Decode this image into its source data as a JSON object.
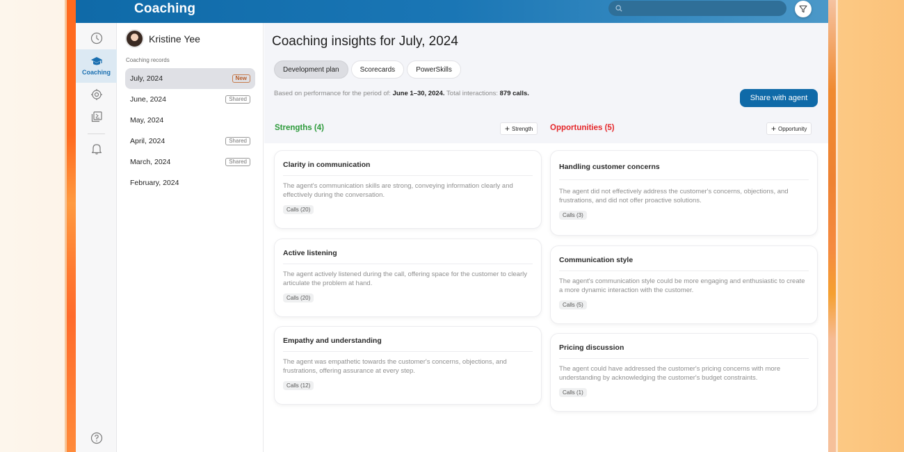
{
  "app": {
    "title": "Coaching",
    "search_placeholder": "",
    "icons": {
      "search": "search-icon",
      "filter": "filter-icon"
    }
  },
  "rail": {
    "items": [
      {
        "name": "history",
        "icon": "clock-icon",
        "label": ""
      },
      {
        "name": "coaching",
        "icon": "graduation-cap-icon",
        "label": "Coaching",
        "active": true
      },
      {
        "name": "targets",
        "icon": "target-icon",
        "label": ""
      },
      {
        "name": "library",
        "icon": "media-library-icon",
        "label": ""
      },
      {
        "name": "notifications",
        "icon": "bell-icon",
        "label": ""
      },
      {
        "name": "help",
        "icon": "help-icon",
        "label": ""
      }
    ]
  },
  "records": {
    "agent_name": "Kristine Yee",
    "section_label": "Coaching records",
    "items": [
      {
        "label": "July, 2024",
        "badge": "New",
        "active": true
      },
      {
        "label": "June, 2024",
        "badge": "Shared"
      },
      {
        "label": "May, 2024",
        "badge": ""
      },
      {
        "label": "April, 2024",
        "badge": "Shared"
      },
      {
        "label": "March, 2024",
        "badge": "Shared"
      },
      {
        "label": "February, 2024",
        "badge": ""
      }
    ]
  },
  "main": {
    "title": "Coaching insights for July, 2024",
    "tabs": [
      {
        "label": "Development plan",
        "active": true
      },
      {
        "label": "Scorecards"
      },
      {
        "label": "PowerSkills"
      }
    ],
    "period": {
      "prefix": "Based on performance for the period of:",
      "range": "June 1–30, 2024.",
      "interactions_label": "Total interactions:",
      "interactions_value": "879 calls."
    },
    "share_button": "Share with agent",
    "strengths": {
      "title": "Strengths (4)",
      "add_label": "Strength",
      "color": "#2c9a3a",
      "cards": [
        {
          "title": "Clarity in communication",
          "desc": "The agent's communication skills are strong, conveying information clearly and effectively during the conversation.",
          "chip": "Calls (20)"
        },
        {
          "title": "Active listening",
          "desc": "The agent actively listened during the call, offering space for the customer to clearly articulate the problem at hand.",
          "chip": "Calls (20)"
        },
        {
          "title": "Empathy and understanding",
          "desc": "The agent was empathetic towards the customer's concerns, objections, and frustrations, offering assurance at every step.",
          "chip": "Calls (12)"
        }
      ]
    },
    "opportunities": {
      "title": "Opportunities (5)",
      "add_label": "Opportunity",
      "color": "#e5282b",
      "cards": [
        {
          "title": "Handling customer concerns",
          "desc": "The agent did not effectively address the customer's concerns, objections, and frustrations, and did not offer proactive solutions.",
          "chip": "Calls (3)"
        },
        {
          "title": "Communication style",
          "desc": "The agent's communication style could be more engaging and enthusiastic to create a more dynamic interaction with the customer.",
          "chip": "Calls (5)"
        },
        {
          "title": "Pricing discussion",
          "desc": "The agent could have addressed the customer's pricing concerns with more understanding by acknowledging the customer's budget constraints.",
          "chip": "Calls (1)"
        }
      ]
    }
  }
}
